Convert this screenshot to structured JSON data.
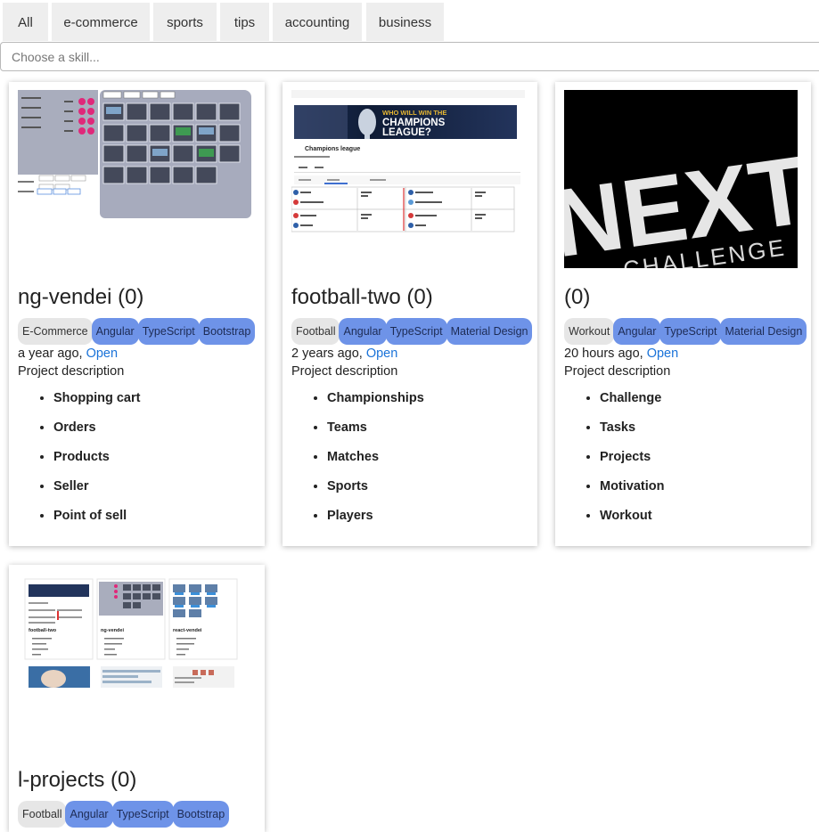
{
  "filters": [
    "All",
    "e-commerce",
    "sports",
    "tips",
    "accounting",
    "business"
  ],
  "search": {
    "placeholder": "Choose a skill..."
  },
  "projects": [
    {
      "title": "ng-vendei (0)",
      "tags": [
        "E-Commerce",
        "Angular",
        "TypeScript",
        "Bootstrap"
      ],
      "time": "a year ago,",
      "link": "Open",
      "description": "Project description",
      "features": [
        "Shopping cart",
        "Orders",
        "Products",
        "Seller",
        "Point of sell"
      ]
    },
    {
      "title": "football-two (0)",
      "tags": [
        "Football",
        "Angular",
        "TypeScript",
        "Material Design"
      ],
      "time": "2 years ago,",
      "link": "Open",
      "description": "Project description",
      "features": [
        "Championships",
        "Teams",
        "Matches",
        "Sports",
        "Players"
      ],
      "thumbnail": {
        "banner_line1": "WHO WILL WIN THE",
        "banner_line2": "CHAMPIONS",
        "banner_line3": "LEAGUE?",
        "heading": "Champions league"
      }
    },
    {
      "title": "(0)",
      "tags": [
        "Workout",
        "Angular",
        "TypeScript",
        "Material Design"
      ],
      "time": "20 hours ago,",
      "link": "Open",
      "description": "Project description",
      "features": [
        "Challenge",
        "Tasks",
        "Projects",
        "Motivation",
        "Workout"
      ],
      "thumbnail": {
        "big": "NEXT",
        "small": "CHALLENGE"
      }
    },
    {
      "title": "l-projects (0)",
      "tags": [
        "Football",
        "Angular",
        "TypeScript",
        "Bootstrap"
      ],
      "thumbnail": {
        "labels": [
          "football-two",
          "ng-vendei",
          "react-vendei"
        ]
      }
    }
  ],
  "colors": {
    "tag_category": "#e6e6e6",
    "tag_tech": "#6e93e8",
    "link": "#1a73d9",
    "filter_bg": "#eeeeee"
  }
}
